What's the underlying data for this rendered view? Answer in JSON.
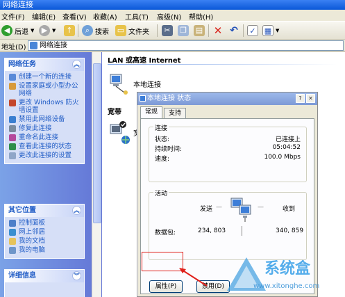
{
  "window": {
    "title": "网络连接"
  },
  "menu": [
    "文件(F)",
    "编辑(E)",
    "查看(V)",
    "收藏(A)",
    "工具(T)",
    "高级(N)",
    "帮助(H)"
  ],
  "toolbar": {
    "back": "后退",
    "search": "搜索",
    "folders": "文件夹"
  },
  "address": {
    "label": "地址(D)",
    "value": "网络连接"
  },
  "sidebar": {
    "network_tasks": {
      "title": "网络任务",
      "items": [
        "创建一个新的连接",
        "设置家庭或小型办公网络",
        "更改 Windows 防火墙设置",
        "禁用此网络设备",
        "修复此连接",
        "重命名此连接",
        "查看此连接的状态",
        "更改此连接的设置"
      ]
    },
    "other_places": {
      "title": "其它位置",
      "items": [
        "控制面板",
        "网上邻居",
        "我的文档",
        "我的电脑"
      ]
    },
    "details": {
      "title": "详细信息"
    }
  },
  "content": {
    "lan_group": "LAN 或高速 Internet",
    "local_conn": "本地连接",
    "broadband_group": "宽带",
    "broadband_fragment": "宽"
  },
  "dialog": {
    "title": "本地连接 状态",
    "tabs": [
      "常规",
      "支持"
    ],
    "connection": {
      "legend": "连接",
      "status_label": "状态:",
      "status_value": "已连接上",
      "duration_label": "持续时间:",
      "duration_value": "05:04:52",
      "speed_label": "速度:",
      "speed_value": "100.0 Mbps"
    },
    "activity": {
      "legend": "活动",
      "sent_label": "发送",
      "received_label": "收到",
      "packets_label": "数据包:",
      "sent_value": "234, 803",
      "received_value": "340, 859"
    },
    "properties_button": "属性(P)",
    "disable_button": "禁用(D)"
  },
  "watermark": {
    "brand": "系统盒",
    "url": "www.xitonghe.com"
  },
  "colors": {
    "accent": "#215dc6",
    "highlight": "#e0201a"
  }
}
